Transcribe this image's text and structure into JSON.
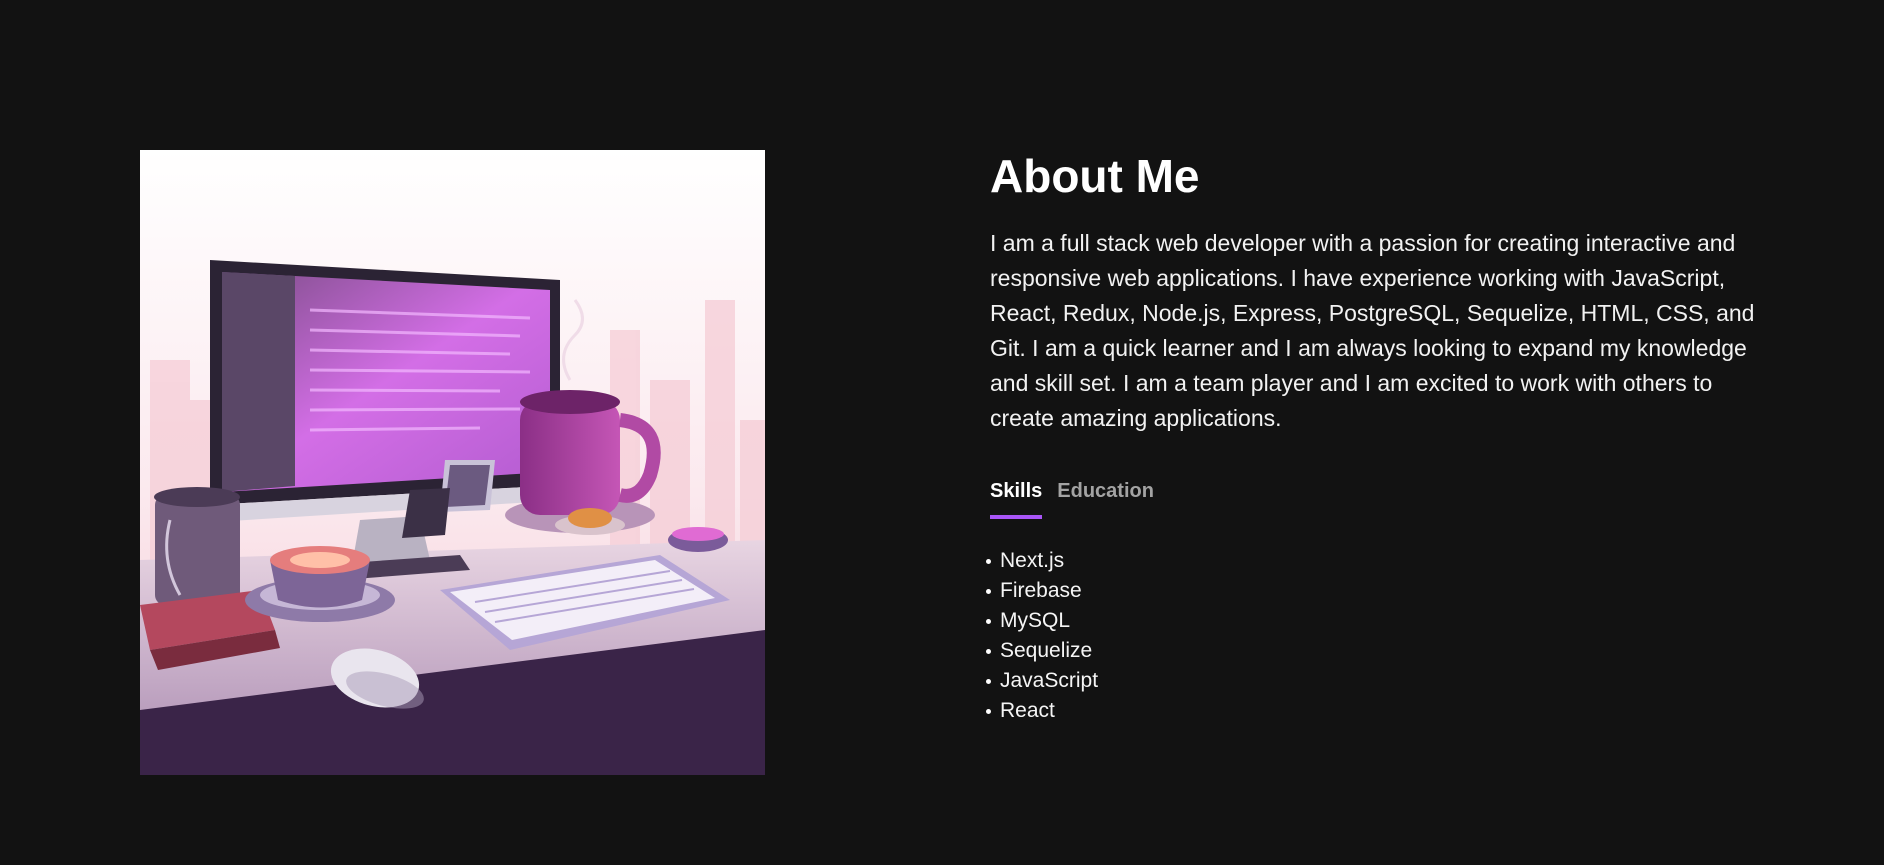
{
  "about": {
    "title": "About Me",
    "bio": "I am a full stack web developer with a passion for creating interactive and responsive web applications. I have experience working with JavaScript, React, Redux, Node.js, Express, PostgreSQL, Sequelize, HTML, CSS, and Git. I am a quick learner and I am always looking to expand my knowledge and skill set. I am a team player and I am excited to work with others to create amazing applications."
  },
  "tabs": [
    {
      "label": "Skills",
      "active": true
    },
    {
      "label": "Education",
      "active": false
    }
  ],
  "skills": [
    "Next.js",
    "Firebase",
    "MySQL",
    "Sequelize",
    "JavaScript",
    "React"
  ],
  "colors": {
    "background": "#121212",
    "accent": "#a855f7",
    "inactive_tab": "#a3a3a3"
  },
  "illustration": {
    "icon": "workspace-desk-illustration"
  }
}
